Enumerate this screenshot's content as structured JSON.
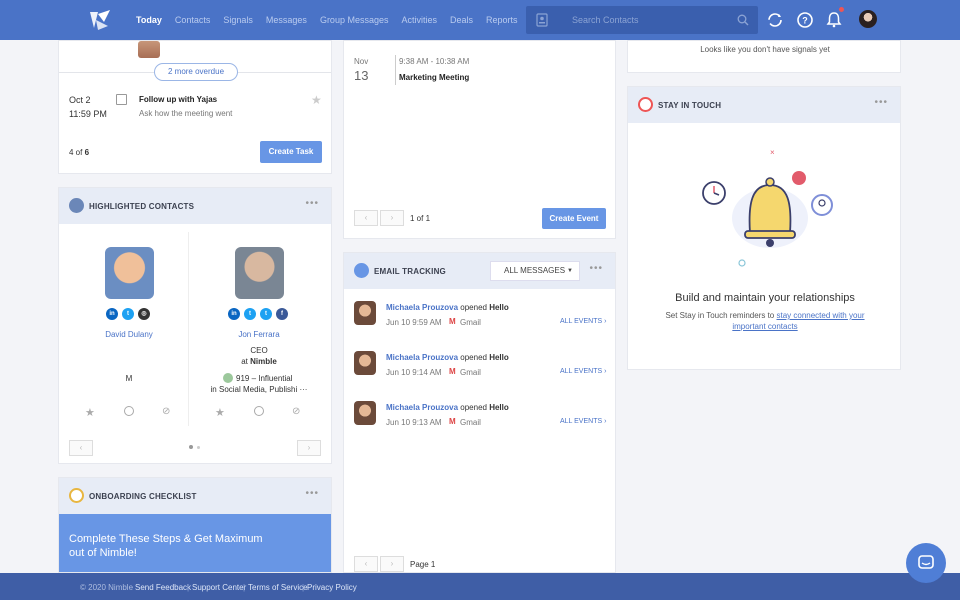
{
  "nav": {
    "items": [
      "Today",
      "Contacts",
      "Signals",
      "Messages",
      "Group Messages",
      "Activities",
      "Deals",
      "Reports"
    ],
    "search_placeholder": "Search Contacts"
  },
  "tasks": {
    "overdue_label": "2 more overdue",
    "task_date": "Oct 2",
    "task_time": "11:59 PM",
    "task_title": "Follow up with Yajas",
    "task_desc": "Ask how the meeting went",
    "count_prefix": "4 of",
    "count_total": "6",
    "create_button": "Create Task"
  },
  "highlighted": {
    "title": "HIGHLIGHTED CONTACTS",
    "contacts": [
      {
        "name": "David Dulany",
        "extra": "M"
      },
      {
        "name": "Jon Ferrara",
        "role": "CEO",
        "at": "at",
        "company": "Nimble",
        "score": "919 – Influential",
        "interests": "in Social Media, Publishi ···"
      }
    ]
  },
  "onboarding": {
    "title": "ONBOARDING CHECKLIST",
    "banner": "Complete These Steps & Get Maximum out of Nimble!"
  },
  "events": {
    "month": "Nov",
    "day": "13",
    "time": "9:38 AM - 10:38 AM",
    "title": "Marketing Meeting",
    "page_info": "1 of 1",
    "create_button": "Create Event"
  },
  "email_tracking": {
    "title": "EMAIL TRACKING",
    "filter": "ALL MESSAGES",
    "all_events": "ALL EVENTS",
    "items": [
      {
        "name": "Michaela Prouzova",
        "action": "opened",
        "subject": "Hello",
        "time": "Jun 10 9:59 AM",
        "source": "Gmail"
      },
      {
        "name": "Michaela Prouzova",
        "action": "opened",
        "subject": "Hello",
        "time": "Jun 10 9:14 AM",
        "source": "Gmail"
      },
      {
        "name": "Michaela Prouzova",
        "action": "opened",
        "subject": "Hello",
        "time": "Jun 10 9:13 AM",
        "source": "Gmail"
      }
    ],
    "page_label": "Page 1"
  },
  "signals": {
    "empty_text": "Looks like you don't have signals yet"
  },
  "stay_in_touch": {
    "title": "STAY IN TOUCH",
    "heading": "Build and maintain your relationships",
    "desc_prefix": "Set Stay in Touch reminders to",
    "desc_link": "stay connected with your important contacts"
  },
  "footer": {
    "copyright": "© 2020 Nimble",
    "links": [
      "Send Feedback",
      "Support Center",
      "Terms of Service",
      "Privacy Policy"
    ]
  },
  "colors": {
    "topbar": "#4a73c7",
    "accent": "#6896e5",
    "footer": "#3f5ea6"
  }
}
